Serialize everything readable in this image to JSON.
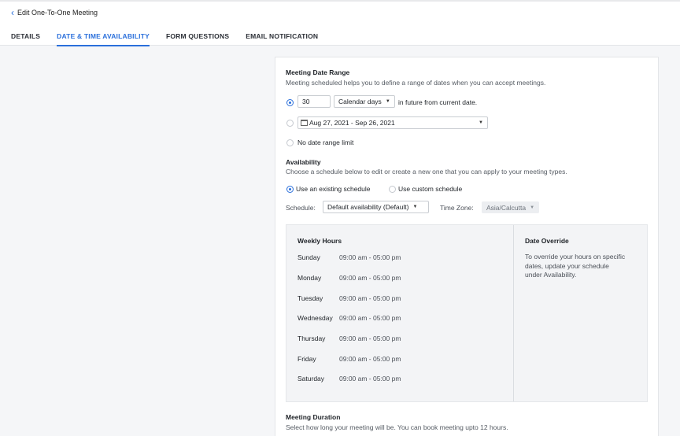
{
  "header": {
    "back_label": "Edit One-To-One Meeting",
    "tabs": [
      {
        "label": "DETAILS",
        "active": false
      },
      {
        "label": "DATE & TIME AVAILABILITY",
        "active": true
      },
      {
        "label": "FORM QUESTIONS",
        "active": false
      },
      {
        "label": "EMAIL NOTIFICATION",
        "active": false
      }
    ]
  },
  "date_range": {
    "title": "Meeting Date Range",
    "subtitle": "Meeting scheduled helps you to define a range of dates when you can accept meetings.",
    "days_value": "30",
    "days_unit": "Calendar days",
    "days_suffix": "in future from current date.",
    "range_value": "Aug 27, 2021 - Sep 26, 2021",
    "no_limit_label": "No date range limit"
  },
  "availability": {
    "title": "Availability",
    "subtitle": "Choose a schedule below to edit or create a new one that you can apply to your meeting types.",
    "existing_label": "Use an existing schedule",
    "custom_label": "Use custom schedule",
    "schedule_label": "Schedule:",
    "schedule_value": "Default availability (Default)",
    "timezone_label": "Time Zone:",
    "timezone_value": "Asia/Calcutta"
  },
  "weekly_hours": {
    "title": "Weekly Hours",
    "days": [
      {
        "day": "Sunday",
        "hours": "09:00 am - 05:00 pm"
      },
      {
        "day": "Monday",
        "hours": "09:00 am - 05:00 pm"
      },
      {
        "day": "Tuesday",
        "hours": "09:00 am - 05:00 pm"
      },
      {
        "day": "Wednesday",
        "hours": "09:00 am - 05:00 pm"
      },
      {
        "day": "Thursday",
        "hours": "09:00 am - 05:00 pm"
      },
      {
        "day": "Friday",
        "hours": "09:00 am - 05:00 pm"
      },
      {
        "day": "Saturday",
        "hours": "09:00 am - 05:00 pm"
      }
    ]
  },
  "date_override": {
    "title": "Date Override",
    "text": "To override your hours on specific dates, update your schedule under Availability."
  },
  "duration": {
    "title": "Meeting Duration",
    "subtitle": "Select how long your meeting will be. You can book meeting upto 12 hours."
  },
  "colors": {
    "accent": "#2a6fdb"
  }
}
